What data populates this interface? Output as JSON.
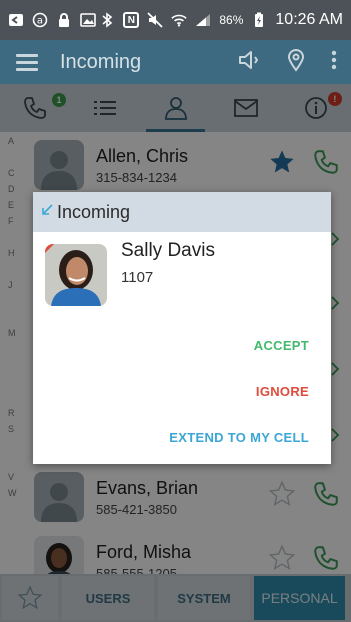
{
  "status_bar": {
    "battery": "86%",
    "time": "10:26 AM"
  },
  "app_bar": {
    "title": "Incoming"
  },
  "tabs": [
    {
      "id": "calls",
      "icon": "phone-icon",
      "badge": "1",
      "badge_color": "#3e9a4e"
    },
    {
      "id": "list",
      "icon": "list-icon"
    },
    {
      "id": "contacts",
      "icon": "person-icon",
      "active": true
    },
    {
      "id": "messages",
      "icon": "envelope-icon"
    },
    {
      "id": "info",
      "icon": "info-icon",
      "badge": "!",
      "badge_color": "#d33a2c"
    }
  ],
  "alphabet": [
    "A",
    "C",
    "D",
    "E",
    "F",
    "H",
    "J",
    "M",
    "R",
    "S",
    "V",
    "W"
  ],
  "contacts": [
    {
      "name": "Allen, Chris",
      "phone": "315-834-1234",
      "favorite": true
    },
    {
      "name": "Evans, Brian",
      "phone": "585-421-3850",
      "favorite": false
    },
    {
      "name": "Ford, Misha",
      "phone": "585-555-1205",
      "favorite": false
    }
  ],
  "bottom_bar": {
    "users": "USERS",
    "system": "SYSTEM",
    "personal": "PERSONAL"
  },
  "dialog": {
    "title": "Incoming",
    "caller_name": "Sally Davis",
    "caller_ext": "1107",
    "accept": "ACCEPT",
    "ignore": "IGNORE",
    "extend": "EXTEND TO MY CELL"
  },
  "colors": {
    "status_bar": "#4c5257",
    "app_bar": "#3d6a80",
    "tab_bar": "#c8d4db",
    "accept": "#43b96e",
    "ignore": "#e04a3c",
    "extend": "#3aa7d6",
    "favorite_star": "#2a6fa5",
    "call_green": "#3a9b55"
  }
}
